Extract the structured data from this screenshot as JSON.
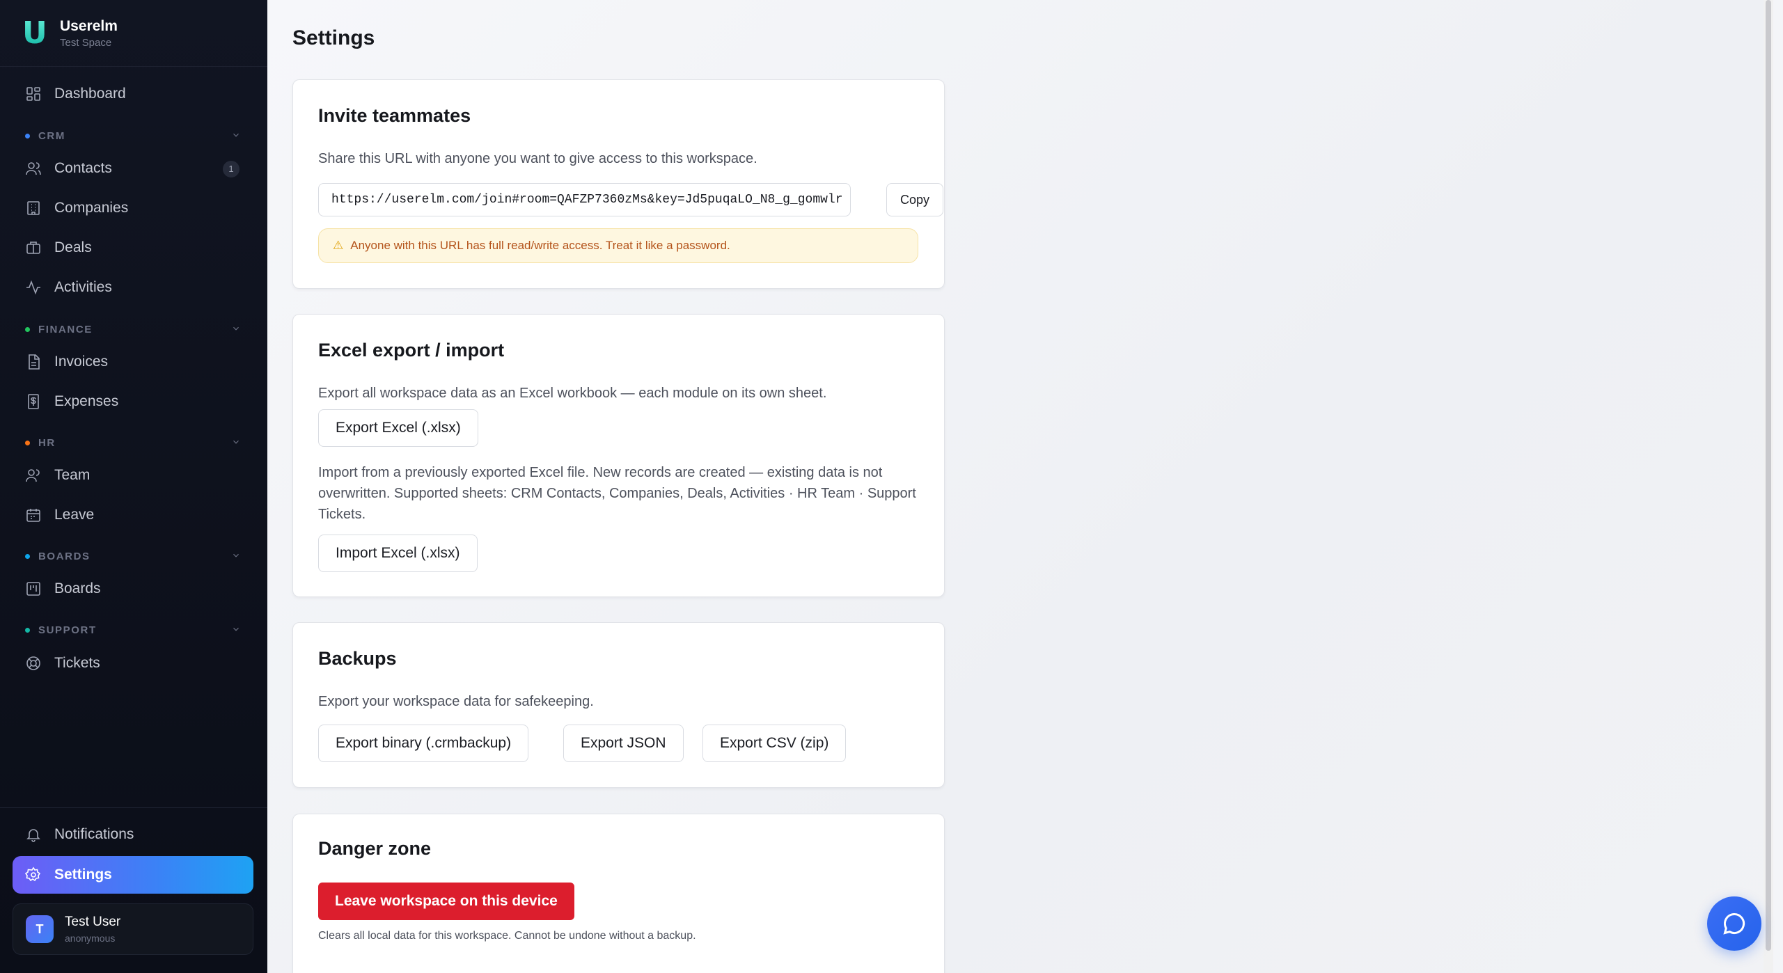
{
  "brand": {
    "name": "Userelm",
    "workspace": "Test Space",
    "logo_letter": "U"
  },
  "sidebar": {
    "dashboard": "Dashboard",
    "sections": [
      {
        "label": "CRM",
        "color": "#3b82f6"
      },
      {
        "label": "FINANCE",
        "color": "#22c55e"
      },
      {
        "label": "HR",
        "color": "#f97316"
      },
      {
        "label": "BOARDS",
        "color": "#0ea5e9"
      },
      {
        "label": "SUPPORT",
        "color": "#14b8a6"
      }
    ],
    "items": {
      "contacts": "Contacts",
      "contacts_badge": "1",
      "companies": "Companies",
      "deals": "Deals",
      "activities": "Activities",
      "invoices": "Invoices",
      "expenses": "Expenses",
      "team": "Team",
      "leave": "Leave",
      "boards": "Boards",
      "tickets": "Tickets"
    },
    "notifications": "Notifications",
    "settings": "Settings",
    "user": {
      "name": "Test User",
      "status": "anonymous",
      "initial": "T"
    }
  },
  "page": {
    "title": "Settings"
  },
  "invite": {
    "title": "Invite teammates",
    "description": "Share this URL with anyone you want to give access to this workspace.",
    "url": "https://userelm.com/join#room=QAFZP7360zMs&key=Jd5puqaLO_N8_g_gomwlr",
    "copy_label": "Copy",
    "warning": "Anyone with this URL has full read/write access. Treat it like a password."
  },
  "excel": {
    "title": "Excel export / import",
    "export_description": "Export all workspace data as an Excel workbook — each module on its own sheet.",
    "export_label": "Export Excel (.xlsx)",
    "import_description": "Import from a previously exported Excel file. New records are created — existing data is not overwritten. Supported sheets: CRM Contacts, Companies, Deals, Activities · HR Team · Support Tickets.",
    "import_label": "Import Excel (.xlsx)"
  },
  "backups": {
    "title": "Backups",
    "description": "Export your workspace data for safekeeping.",
    "binary_label": "Export binary (.crmbackup)",
    "json_label": "Export JSON",
    "csv_label": "Export CSV (zip)"
  },
  "danger": {
    "title": "Danger zone",
    "leave_label": "Leave workspace on this device",
    "note": "Clears all local data for this workspace. Cannot be undone without a backup."
  }
}
